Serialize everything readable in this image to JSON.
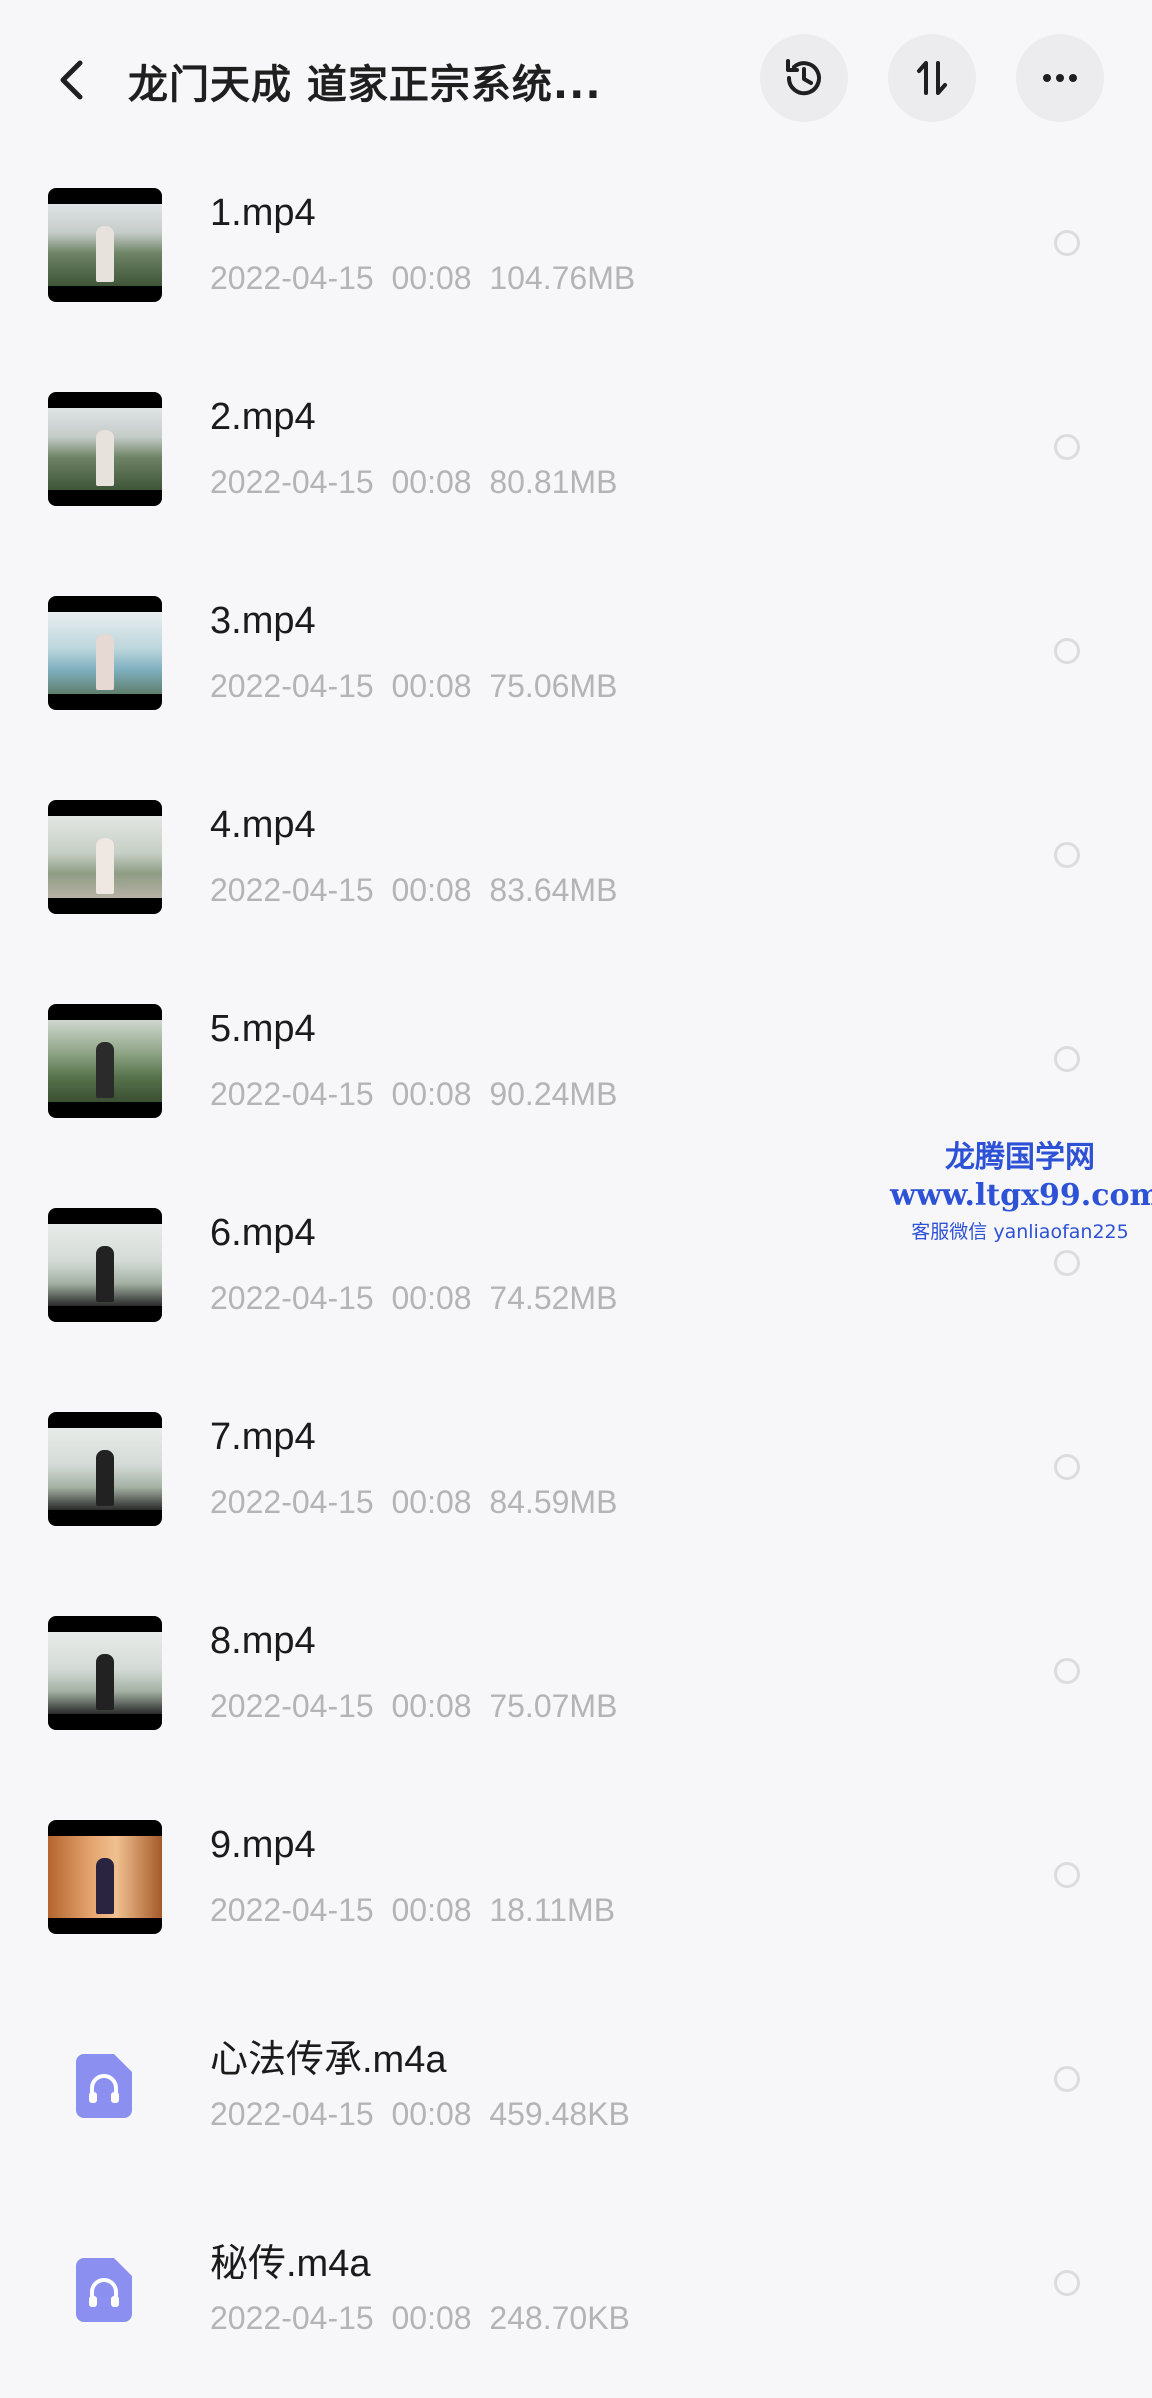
{
  "header": {
    "title": "龙门天成 道家正宗系统...",
    "icons": [
      "back-arrow-icon",
      "history-icon",
      "sort-icon",
      "more-icon"
    ]
  },
  "files": [
    {
      "name": "1.mp4",
      "date": "2022-04-15",
      "time": "00:08",
      "size": "104.76MB",
      "type": "video",
      "thumb": "mountain"
    },
    {
      "name": "2.mp4",
      "date": "2022-04-15",
      "time": "00:08",
      "size": "80.81MB",
      "type": "video",
      "thumb": "mountain"
    },
    {
      "name": "3.mp4",
      "date": "2022-04-15",
      "time": "00:08",
      "size": "75.06MB",
      "type": "video",
      "thumb": "lake"
    },
    {
      "name": "4.mp4",
      "date": "2022-04-15",
      "time": "00:08",
      "size": "83.64MB",
      "type": "video",
      "thumb": "garden"
    },
    {
      "name": "5.mp4",
      "date": "2022-04-15",
      "time": "00:08",
      "size": "90.24MB",
      "type": "video",
      "thumb": "forest"
    },
    {
      "name": "6.mp4",
      "date": "2022-04-15",
      "time": "00:08",
      "size": "74.52MB",
      "type": "video",
      "thumb": "mist"
    },
    {
      "name": "7.mp4",
      "date": "2022-04-15",
      "time": "00:08",
      "size": "84.59MB",
      "type": "video",
      "thumb": "mist"
    },
    {
      "name": "8.mp4",
      "date": "2022-04-15",
      "time": "00:08",
      "size": "75.07MB",
      "type": "video",
      "thumb": "mist"
    },
    {
      "name": "9.mp4",
      "date": "2022-04-15",
      "time": "00:08",
      "size": "18.11MB",
      "type": "video",
      "thumb": "indoor"
    },
    {
      "name": "心法传承.m4a",
      "date": "2022-04-15",
      "time": "00:08",
      "size": "459.48KB",
      "type": "audio"
    },
    {
      "name": "秘传.m4a",
      "date": "2022-04-15",
      "time": "00:08",
      "size": "248.70KB",
      "type": "audio"
    }
  ],
  "watermark": {
    "line1": "龙腾国学网",
    "line2": "www.ltgx99.com",
    "line3": "客服微信 yanliaofan225"
  },
  "colors": {
    "background": "#f7f7f9",
    "meta_text": "#b4b4b8",
    "audio_icon": "#8b8ff0",
    "watermark": "#2d52d6"
  }
}
